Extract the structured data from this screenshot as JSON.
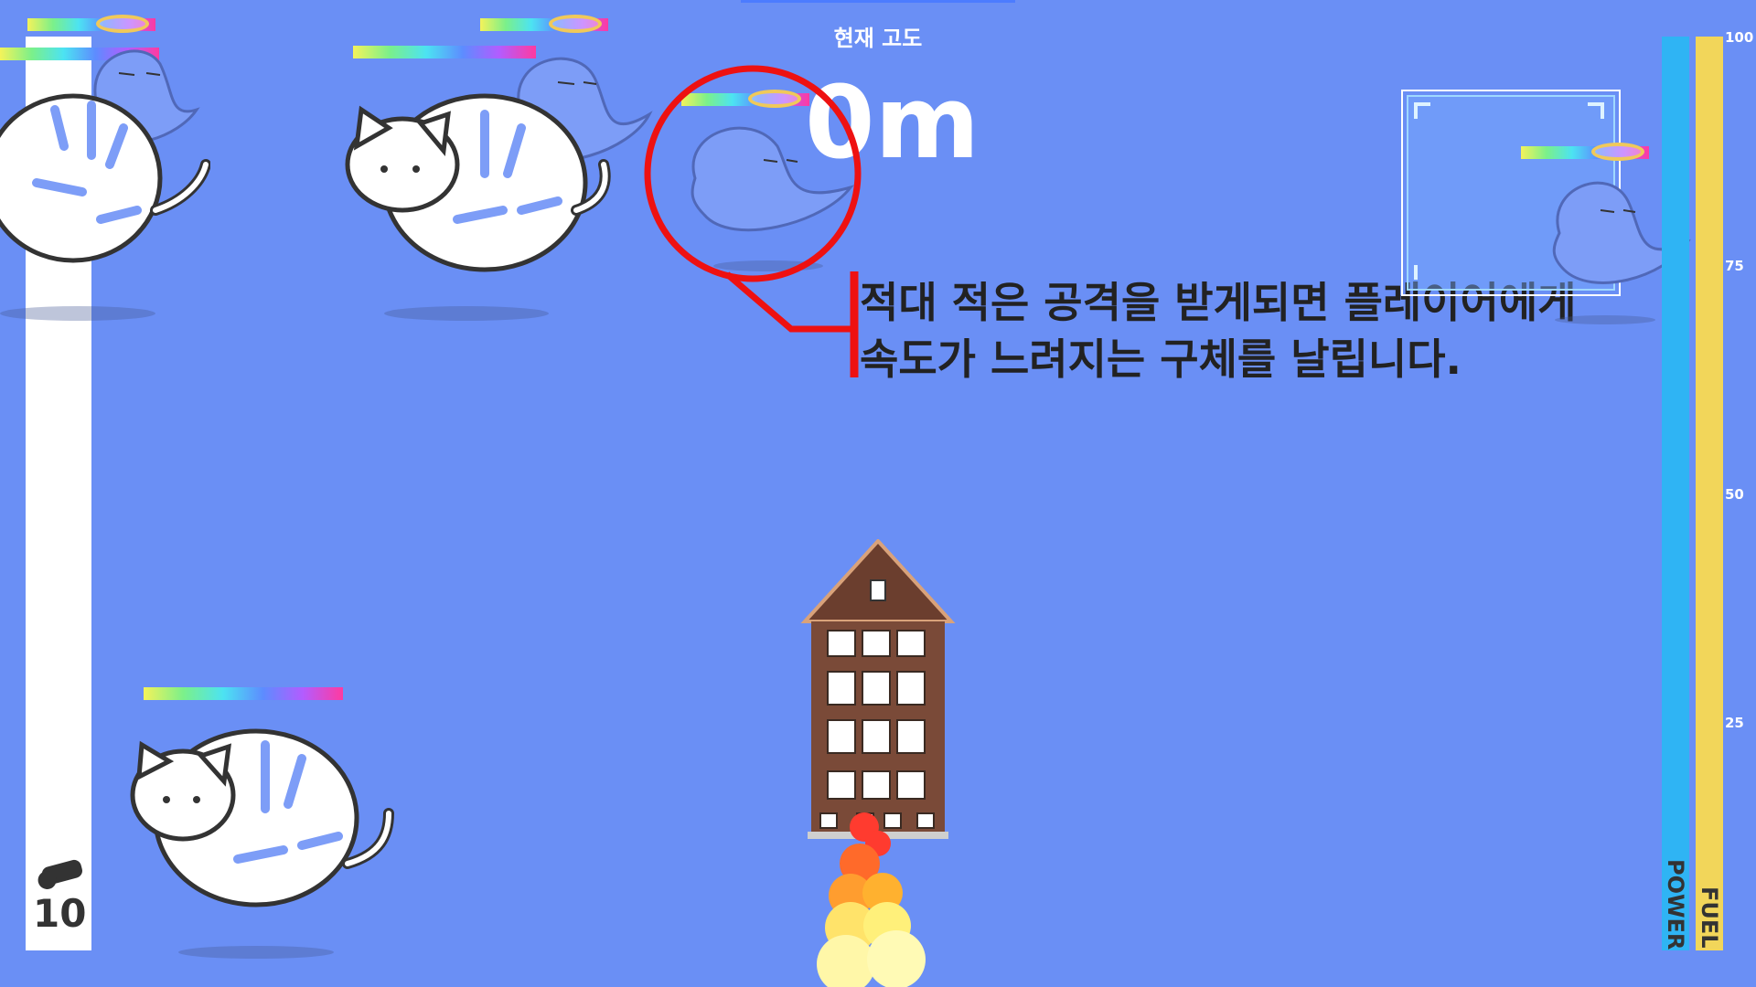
{
  "hud": {
    "altitude_label": "현재 고도",
    "altitude_value": "0m",
    "ammo_count": "10",
    "power_label": "POWER",
    "fuel_label": "FUEL",
    "scale_ticks": [
      "100",
      "75",
      "50",
      "25"
    ]
  },
  "tutorial": {
    "line1": "적대 적은 공격을 받게되면 플레이어에게",
    "line2": "속도가 느려지는 구체를 날립니다."
  },
  "colors": {
    "background": "#6a8ff5",
    "power": "#2fb4f4",
    "fuel": "#f2d65a",
    "callout": "#ee1111"
  }
}
